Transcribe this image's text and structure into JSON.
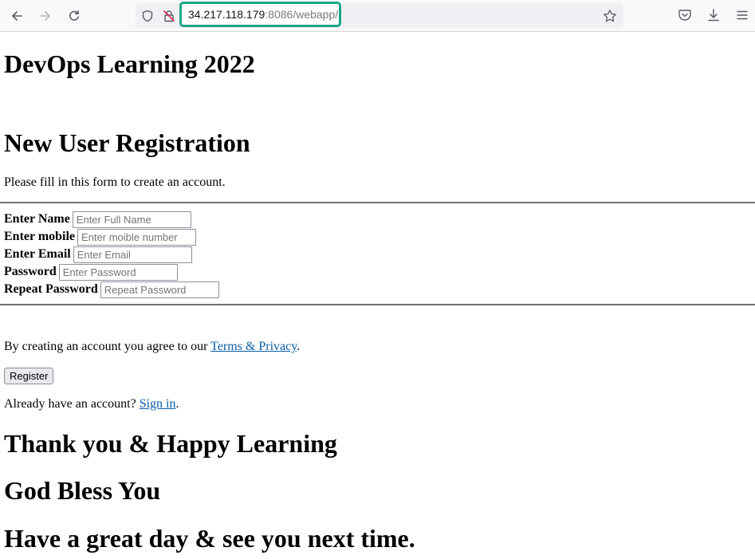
{
  "browser": {
    "url_host": "34.217.118.179",
    "url_rest": ":8086/webapp/"
  },
  "page": {
    "site_title": "DevOps Learning 2022",
    "form_title": "New User Registration",
    "intro": "Please fill in this form to create an account.",
    "fields": [
      {
        "label": "Enter Name",
        "placeholder": "Enter Full Name"
      },
      {
        "label": "Enter mobile",
        "placeholder": "Enter moible number"
      },
      {
        "label": "Enter Email",
        "placeholder": "Enter Email"
      },
      {
        "label": "Password",
        "placeholder": "Enter Password"
      },
      {
        "label": "Repeat Password",
        "placeholder": "Repeat Password"
      }
    ],
    "terms_prefix": "By creating an account you agree to our ",
    "terms_link": "Terms & Privacy",
    "terms_suffix": ".",
    "register_label": "Register",
    "signin_prefix": "Already have an account? ",
    "signin_link": "Sign in",
    "signin_suffix": ".",
    "thanks": "Thank you & Happy Learning",
    "bless": "God Bless You",
    "goodbye": "Have a great day & see you next time."
  },
  "icons": {
    "back": "back-arrow-icon",
    "forward": "forward-arrow-icon",
    "reload": "reload-icon",
    "tracking": "shield-icon",
    "insecure": "insecure-lock-icon",
    "bookmark": "star-icon",
    "pocket": "pocket-icon",
    "downloads": "download-icon",
    "menu": "hamburger-menu-icon"
  }
}
